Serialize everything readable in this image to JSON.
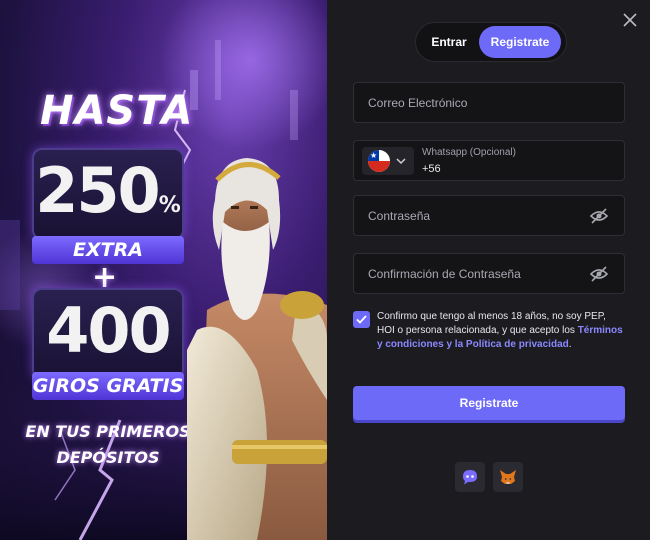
{
  "promo": {
    "hasta": "HASTA",
    "bonus_value": "250",
    "bonus_unit": "%",
    "bonus_label": "EXTRA",
    "plus": "+",
    "spins_value": "400",
    "spins_label": "GIROS GRATIS",
    "deposits_line1": "EN TUS PRIMEROS",
    "deposits_line2": "DEPÓSITOS"
  },
  "tabs": [
    {
      "label": "Entrar",
      "active": false
    },
    {
      "label": "Registrate",
      "active": true
    }
  ],
  "form": {
    "email_placeholder": "Correo Electrónico",
    "whatsapp_label": "Whatsapp (Opcional)",
    "country_code": "+56",
    "country_flag": "chile-flag-icon",
    "password_placeholder": "Contraseña",
    "confirm_placeholder": "Confirmación de Contraseña",
    "consent_text": "Confirmo que tengo al menos 18 años, no soy PEP, HOI o persona relacionada, y que acepto los",
    "consent_link": "Términos y condiciones y la Política de privacidad",
    "consent_end": ".",
    "consent_checked": true,
    "submit_label": "Registrate"
  },
  "social_icons": [
    "chat-bubble-icon",
    "metamask-fox-icon"
  ],
  "colors": {
    "accent": "#6e6af8",
    "panel_bg": "#1c1c20",
    "field_bg": "#141417",
    "link": "#8b88ff"
  }
}
